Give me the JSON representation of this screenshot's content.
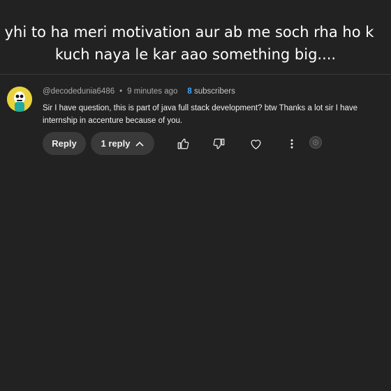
{
  "caption": {
    "line1": "yhi to ha meri motivation aur ab me soch rha ho k",
    "line2": "kuch naya le kar aao something big...."
  },
  "comment": {
    "author": "@decodedunia6486",
    "separator": "•",
    "time": "9 minutes ago",
    "subscriber_count": "8",
    "subscriber_label": "subscribers",
    "text": "Sir I have question, this is part of java full stack development? btw Thanks a lot sir I have internship in accenture because of you."
  },
  "actions": {
    "reply_label": "Reply",
    "replies_label": "1 reply",
    "icons": [
      "thumbs-up-icon",
      "thumbs-down-icon",
      "heart-icon",
      "more-vertical-icon",
      "channel-avatar-icon"
    ]
  },
  "colors": {
    "background": "#222222",
    "button_bg": "#3a3a3a",
    "subscriber_accent": "#3ea6ff",
    "avatar_bg": "#e9d23a"
  }
}
